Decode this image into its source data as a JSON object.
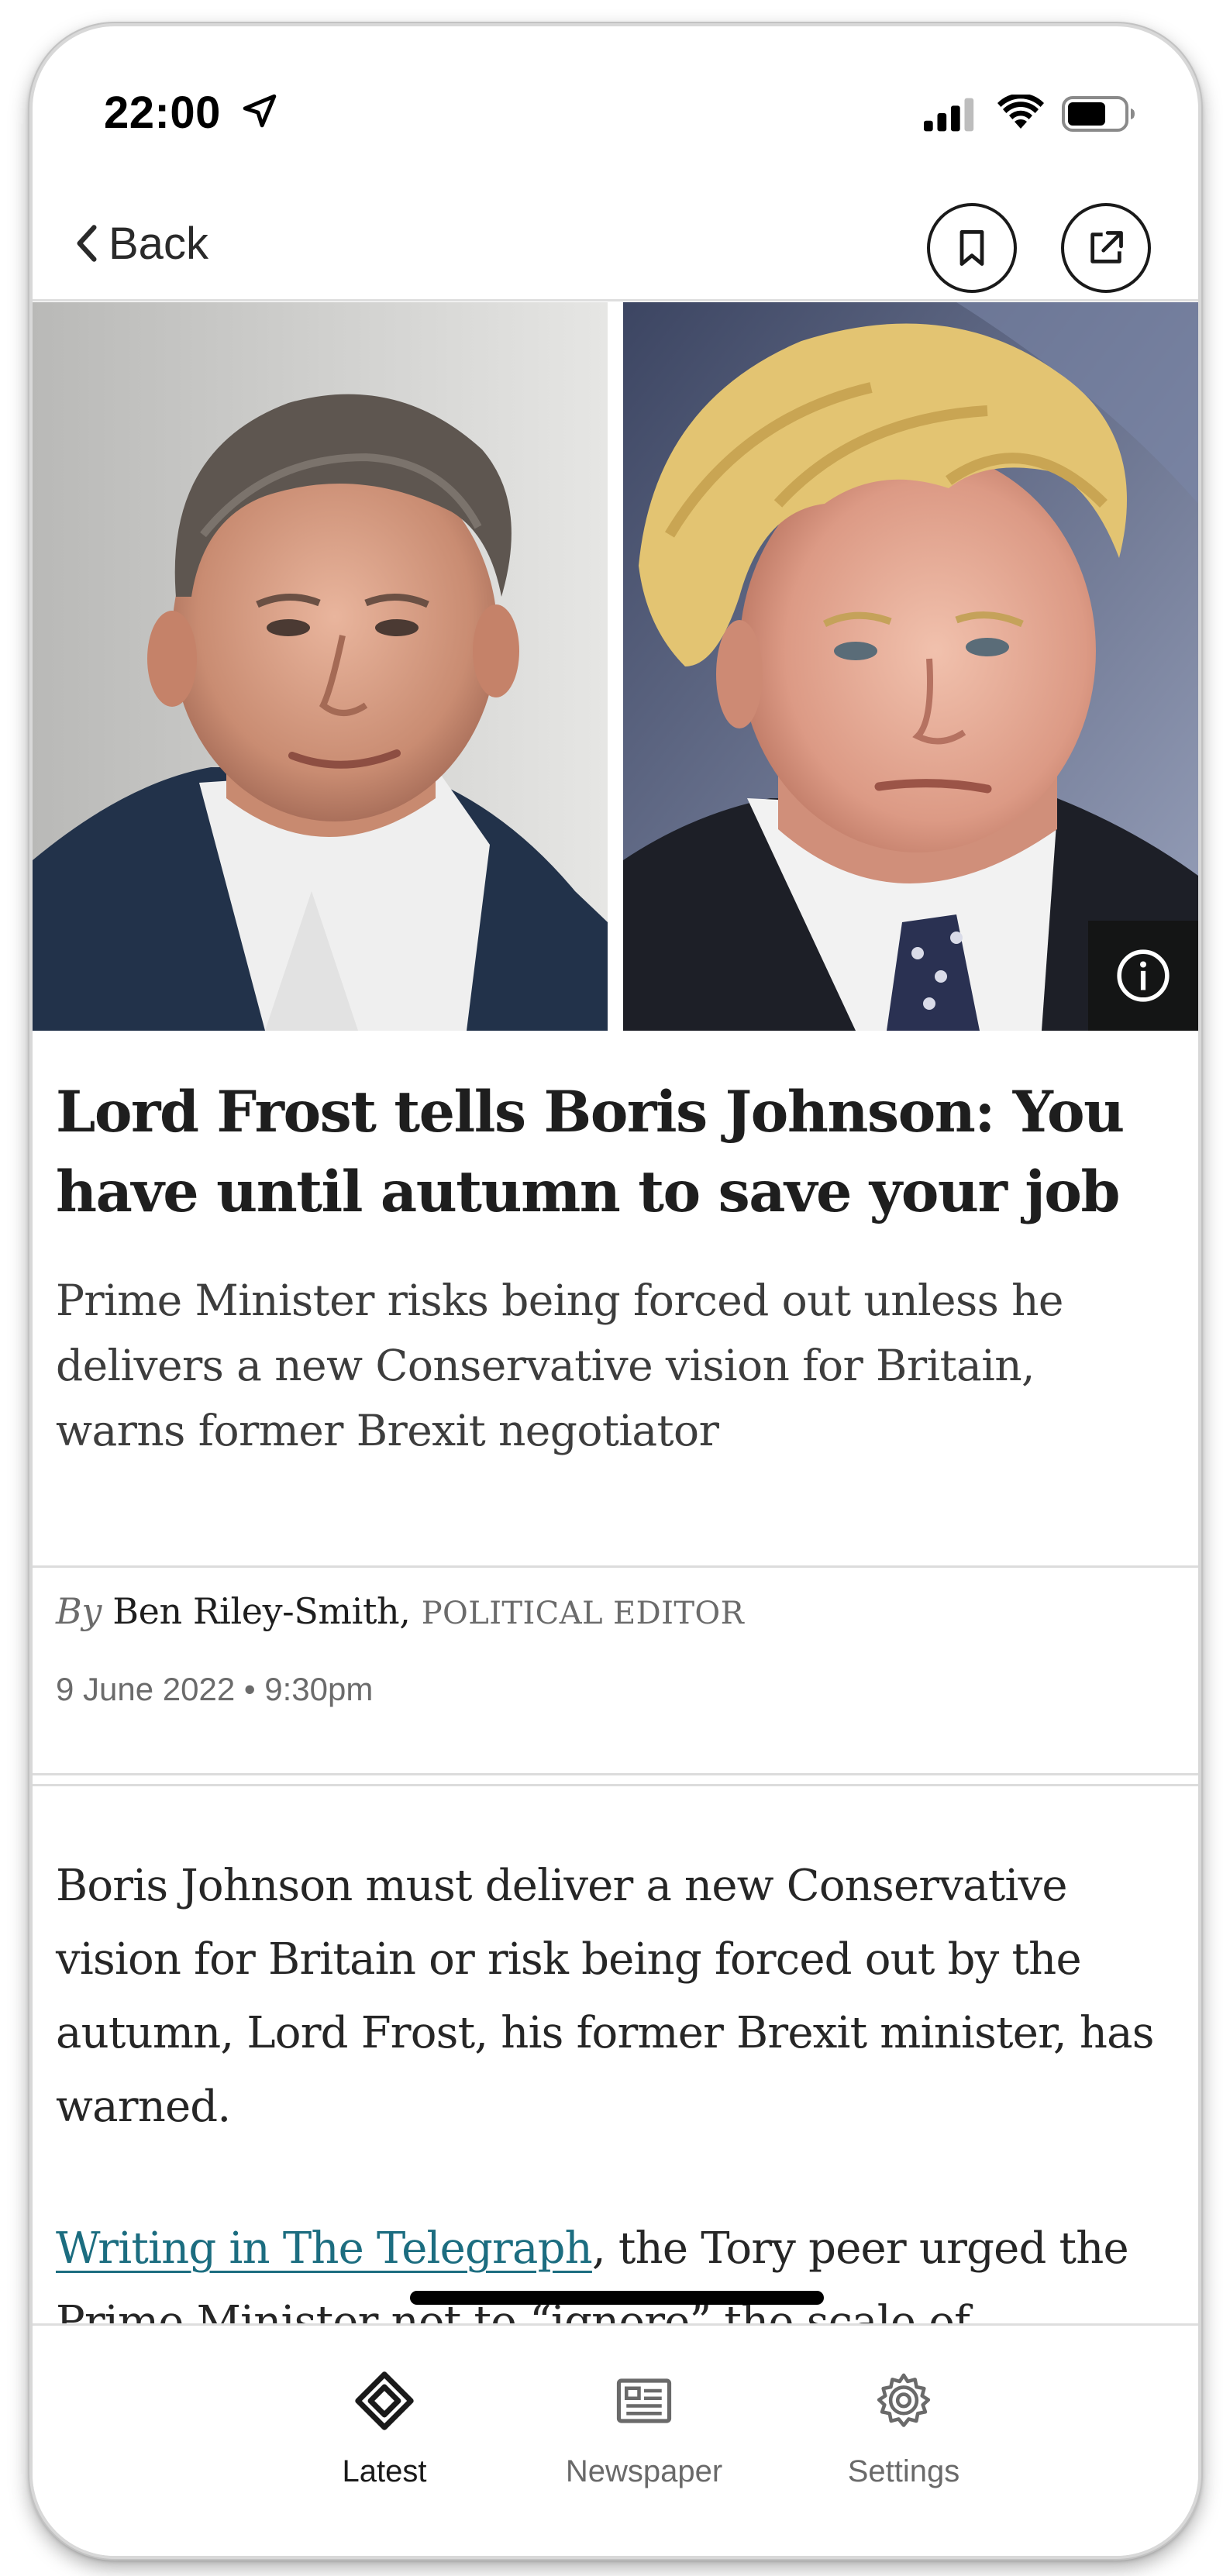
{
  "status_bar": {
    "time": "22:00",
    "location_icon": "location-arrow-icon",
    "signal_icon": "cellular-signal-icon",
    "wifi_icon": "wifi-icon",
    "battery_icon": "battery-icon"
  },
  "nav": {
    "back_label": "Back",
    "bookmark_icon": "bookmark-icon",
    "share_icon": "share-external-icon"
  },
  "hero": {
    "info_icon": "info-icon"
  },
  "article": {
    "headline": "Lord Frost tells Boris Johnson: You have until autumn to save your job",
    "standfirst": "Prime Minister risks being forced out unless he delivers a new Conservative vision for Britain, warns former Brexit negotiator",
    "byline_prefix": "By",
    "author": "Ben Riley-Smith,",
    "author_role": "POLITICAL EDITOR",
    "date": "9 June 2022 • 9:30pm",
    "paragraph1": "Boris Johnson must deliver a new Conservative vision for Britain or risk being forced out by the autumn, Lord Frost, his former Brexit minister, has warned.",
    "paragraph2_link": "Writing in The Telegraph",
    "paragraph2_rest": ", the Tory peer urged the Prime Minister not to “ignore” the scale of"
  },
  "tabs": [
    {
      "label": "Latest",
      "icon": "diamond-latest-icon",
      "active": true
    },
    {
      "label": "Newspaper",
      "icon": "newspaper-icon",
      "active": false
    },
    {
      "label": "Settings",
      "icon": "gear-icon",
      "active": false
    }
  ],
  "colors": {
    "link": "#1c6d80",
    "text": "#1e1e1e",
    "muted": "#6b6b6b"
  }
}
